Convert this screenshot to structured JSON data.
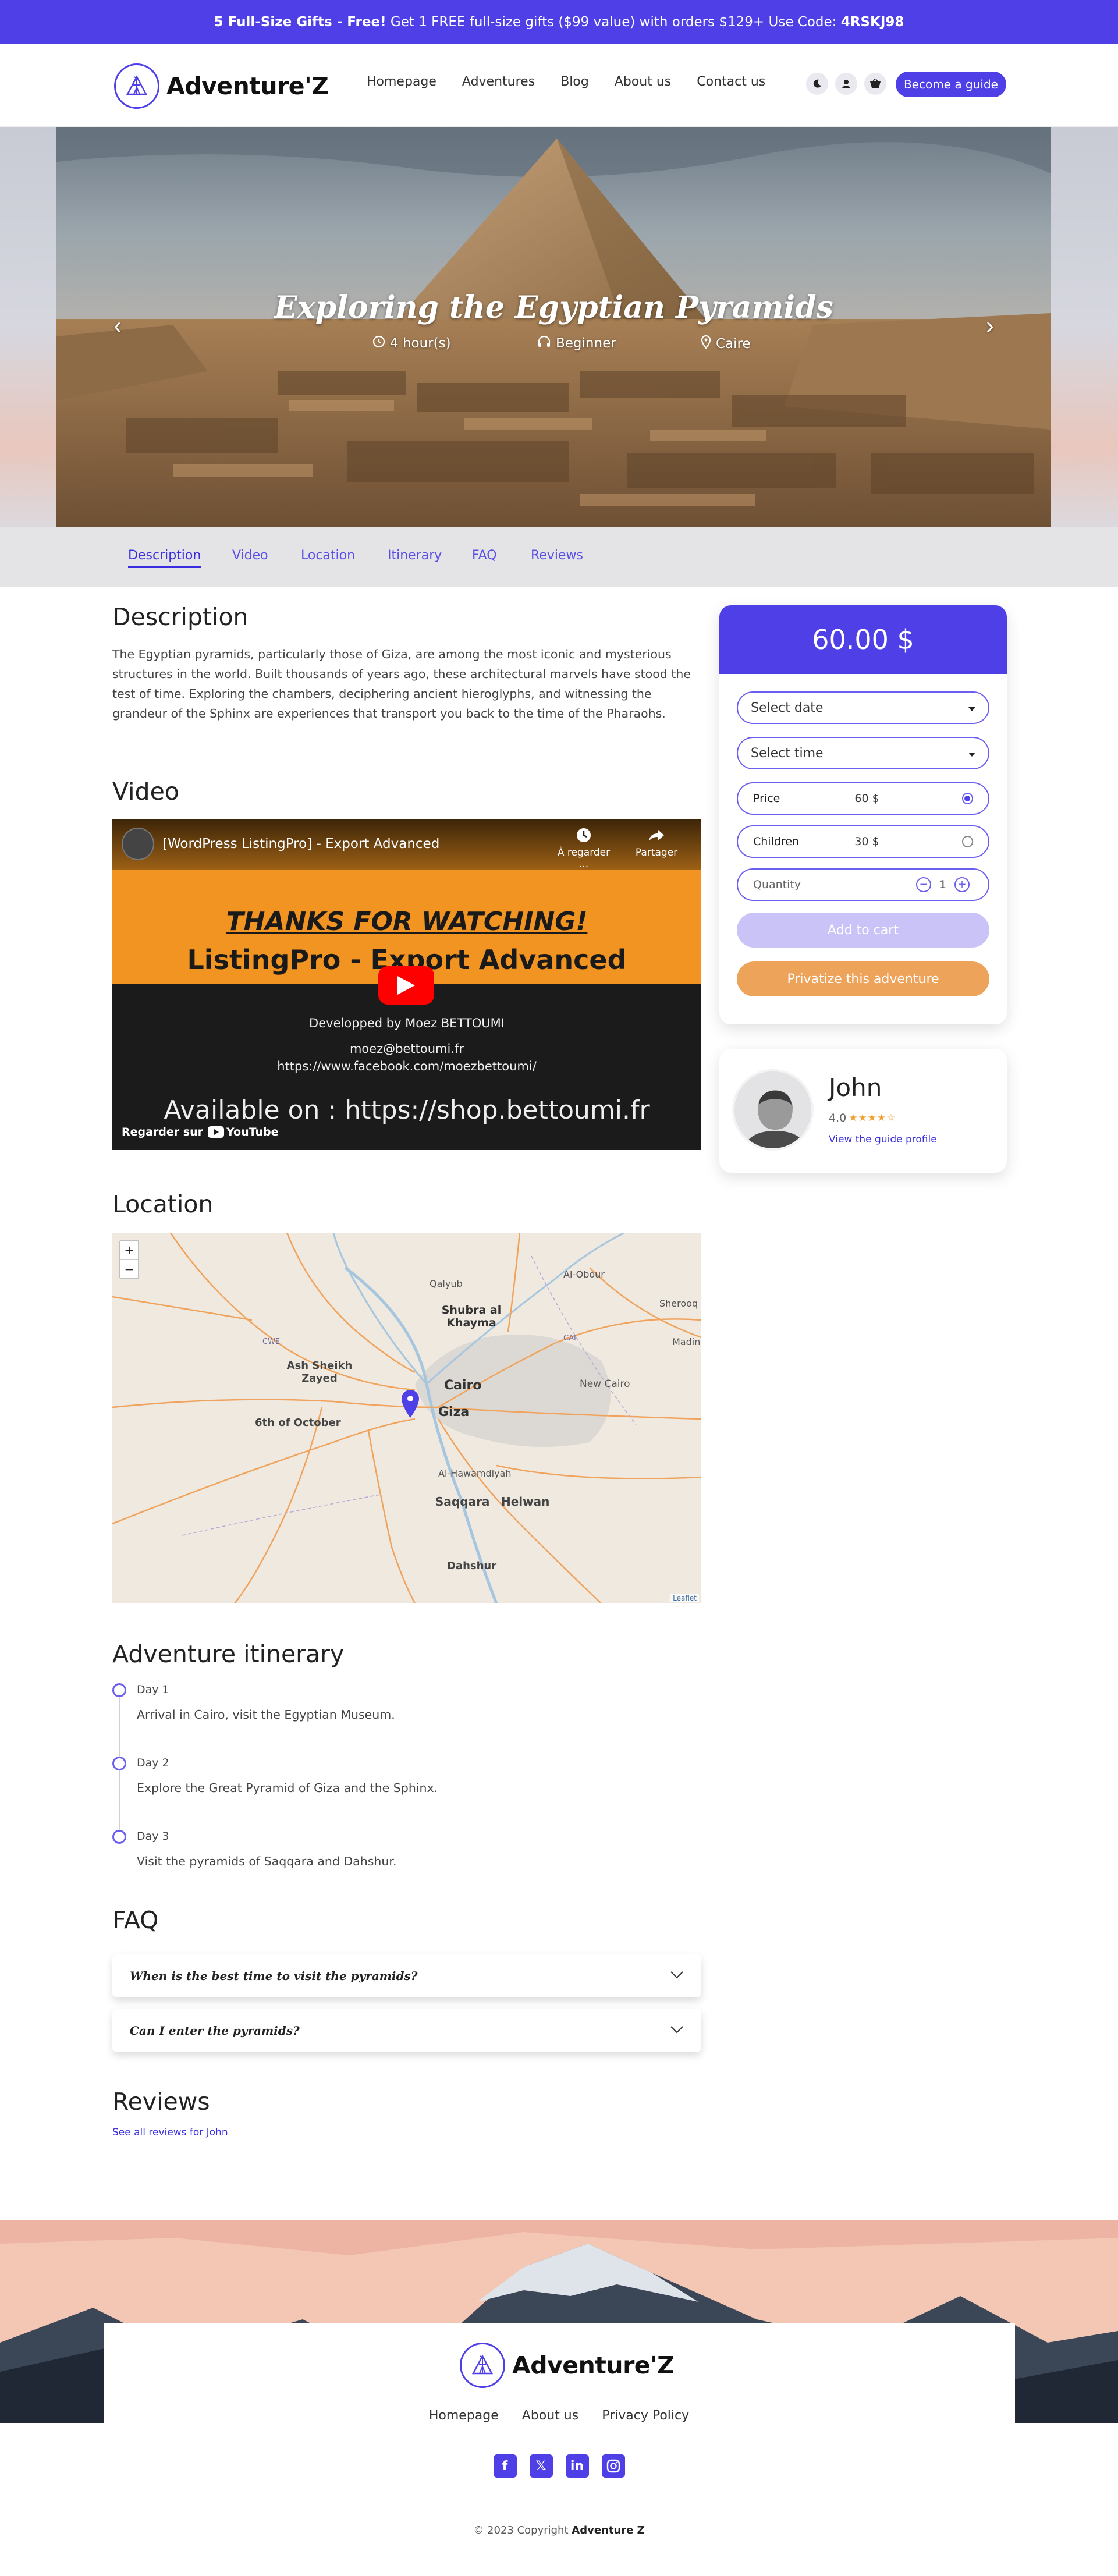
{
  "promo": {
    "strong": "5 Full-Size Gifts - Free!",
    "text": "Get 1 FREE full-size gifts ($99 value) with orders $129+ Use Code:",
    "code": "4RSKJ98"
  },
  "header": {
    "logo_text": "Adventure'Z",
    "nav": [
      "Homepage",
      "Adventures",
      "Blog",
      "About us",
      "Contact us"
    ],
    "cta": "Become a guide"
  },
  "hero": {
    "title": "Exploring the Egyptian Pyramids",
    "duration": "4 hour(s)",
    "level": "Beginner",
    "city": "Caire"
  },
  "tabs": [
    "Description",
    "Video",
    "Location",
    "Itinerary",
    "FAQ",
    "Reviews"
  ],
  "description": {
    "title": "Description",
    "text": "The Egyptian pyramids, particularly those of Giza, are among the most iconic and mysterious structures in the world. Built thousands of years ago, these architectural marvels have stood the test of time. Exploring the chambers, deciphering ancient hieroglyphs, and witnessing the grandeur of the Sphinx are experiences that transport you back to the time of the Pharaohs."
  },
  "video": {
    "title": "Video",
    "yt_title": "[WordPress ListingPro] - Export Advanced",
    "watch_later": "À regarder ...",
    "share": "Partager",
    "thanks": "THANKS FOR WATCHING!",
    "product": "ListingPro - Export Advanced",
    "dev": "Developped by Moez BETTOUMI",
    "email": "moez@bettoumi.fr",
    "facebook": "https://www.facebook.com/moezbettoumi/",
    "available": "Available on : https://shop.bettoumi.fr",
    "watch_on": "Regarder sur",
    "youtube": "YouTube"
  },
  "location": {
    "title": "Location",
    "zoom_in": "+",
    "zoom_out": "−",
    "attribution": "Leaflet",
    "places": {
      "cairo": "Cairo",
      "giza": "Giza",
      "shubra": "Shubra al Khayma",
      "qalyub": "Qalyub",
      "obour": "Al-Obour",
      "sherook": "Sherooq",
      "madinaty": "Madin",
      "new_cairo": "New Cairo",
      "sheikh_zayed": "Ash Sheikh Zayed",
      "october": "6th of October",
      "hawamdiyah": "Al-Hawamdiyah",
      "saqqara": "Saqqara",
      "helwan": "Helwan",
      "dahshur": "Dahshur",
      "cwe": "CWE",
      "cai": "CAI"
    }
  },
  "itinerary": {
    "title": "Adventure itinerary",
    "days": [
      {
        "day": "Day 1",
        "text": "Arrival in Cairo, visit the Egyptian Museum."
      },
      {
        "day": "Day 2",
        "text": "Explore the Great Pyramid of Giza and the Sphinx."
      },
      {
        "day": "Day 3",
        "text": "Visit the pyramids of Saqqara and Dahshur."
      }
    ]
  },
  "faq": {
    "title": "FAQ",
    "items": [
      "When is the best time to visit the pyramids?",
      "Can I enter the pyramids?"
    ]
  },
  "reviews": {
    "title": "Reviews",
    "link": "See all reviews for John"
  },
  "booking": {
    "price": "60.00 $",
    "select_date": "Select date",
    "select_time": "Select time",
    "price_label": "Price",
    "price_value": "60 $",
    "children_label": "Children",
    "children_value": "30 $",
    "quantity_label": "Quantity",
    "quantity_value": "1",
    "add_to_cart": "Add to cart",
    "privatize": "Privatize this adventure"
  },
  "guide": {
    "name": "John",
    "rating": "4.0",
    "stars_filled": 4,
    "stars_total": 5,
    "profile_link": "View the guide profile"
  },
  "footer": {
    "logo_text": "Adventure'Z",
    "links": [
      "Homepage",
      "About us",
      "Privacy Policy"
    ],
    "social": [
      "facebook-icon",
      "x-icon",
      "linkedin-icon",
      "instagram-icon"
    ],
    "copyright": "© 2023 Copyright",
    "brand": "Adventure Z"
  },
  "colors": {
    "accent": "#4f3fe6",
    "orange": "#eea35a",
    "disabled": "#c9c3f7"
  }
}
